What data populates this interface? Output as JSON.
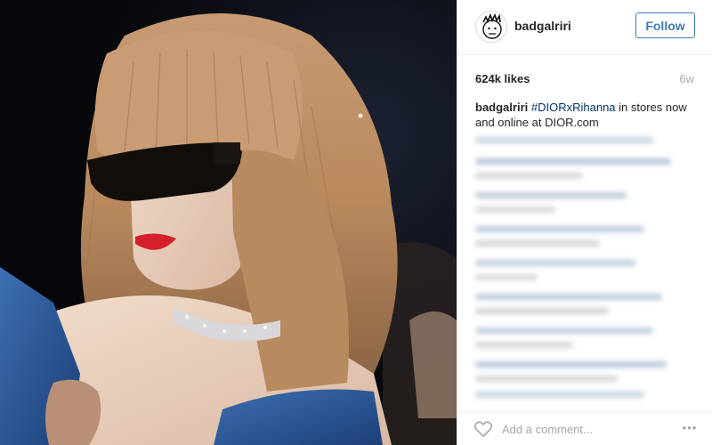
{
  "post": {
    "image_alt": "woman with bangs wearing dark wraparound sunglasses and a crystal choker",
    "header": {
      "username": "badgalriri",
      "follow_label": "Follow"
    },
    "meta": {
      "likes": "624k likes",
      "age": "6w"
    },
    "caption": {
      "username": "badgalriri",
      "hashtag": "#DIORxRihanna",
      "text": " in stores now and online at DIOR.com"
    },
    "comments_blurred": true,
    "footer": {
      "comment_placeholder": "Add a comment...",
      "more_label": "•••",
      "like_icon": "heart-outline-icon"
    }
  },
  "colors": {
    "link_blue": "#3f7bb8",
    "hashtag": "#003569",
    "muted": "#a5a7aa",
    "divider": "#efefef"
  }
}
